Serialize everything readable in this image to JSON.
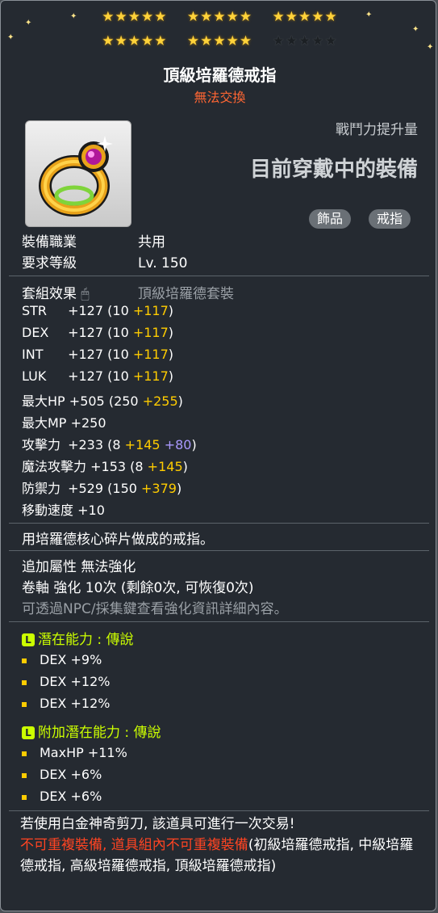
{
  "stars": {
    "row1": [
      "★★★★★",
      "★★★★★",
      "★★★★★"
    ],
    "row2_on": [
      "★★★★★",
      "★★★★★"
    ],
    "row2_off": "★★★★★"
  },
  "item": {
    "name": "頂級培羅德戒指",
    "trade_status": "無法交換",
    "combat_power_label": "戰鬥力提升量",
    "equipped_text": "目前穿戴中的裝備",
    "tags": [
      "飾品",
      "戒指"
    ]
  },
  "requirements": {
    "job_label": "裝備職業",
    "job_value": "共用",
    "level_label": "要求等級",
    "level_value": "Lv. 150"
  },
  "set": {
    "label": "套組效果",
    "value": "頂級培羅德套裝"
  },
  "stats": [
    {
      "name": "STR",
      "total": "+127",
      "base": "(10",
      "bonus": "+117",
      "bonus2": "",
      ")": ")"
    },
    {
      "name": "DEX",
      "total": "+127",
      "base": "(10",
      "bonus": "+117",
      "bonus2": "",
      ")": ")"
    },
    {
      "name": "INT",
      "total": "+127",
      "base": "(10",
      "bonus": "+117",
      "bonus2": "",
      ")": ")"
    },
    {
      "name": "LUK",
      "total": "+127",
      "base": "(10",
      "bonus": "+117",
      "bonus2": "",
      ")": ")"
    },
    {
      "name": "最大HP",
      "total": "+505",
      "base": "(250",
      "bonus": "+255",
      "bonus2": "",
      ")": ")"
    },
    {
      "name": "最大MP",
      "total": "+250",
      "base": "",
      "bonus": "",
      "bonus2": "",
      ")": ""
    },
    {
      "name": "攻擊力",
      "total": "+233",
      "base": "(8",
      "bonus": "+145",
      "bonus2": "+80",
      ")": ")"
    },
    {
      "name": "魔法攻擊力",
      "total": "+153",
      "base": "(8",
      "bonus": "+145",
      "bonus2": "",
      ")": ")"
    },
    {
      "name": "防禦力",
      "total": "+529",
      "base": "(150",
      "bonus": "+379",
      "bonus2": "",
      ")": ")"
    },
    {
      "name": "移動速度",
      "total": "+10",
      "base": "",
      "bonus": "",
      "bonus2": "",
      ")": ""
    }
  ],
  "description": "用培羅德核心碎片做成的戒指。",
  "extra": {
    "line1": "追加屬性 無法強化",
    "line2": "卷軸 強化 10次 (剩餘0次, 可恢復0次)",
    "line3": "可透過NPC/採集鍵查看強化資訊詳細內容。"
  },
  "potential": {
    "title": "潛在能力 : 傳說",
    "lines": [
      "DEX +9%",
      "DEX +12%",
      "DEX +12%"
    ]
  },
  "bonus_potential": {
    "title": "附加潛在能力 : 傳說",
    "lines": [
      "MaxHP +11%",
      "DEX +6%",
      "DEX +6%"
    ]
  },
  "trade_note": {
    "line1": "若使用白金神奇剪刀, 該道具可進行一次交易!",
    "warning": "不可重複裝備, 道具組內不可重複裝備",
    "rest": "(初級培羅德戒指, 中級培羅德戒指, 高級培羅德戒指, 頂級培羅德戒指)"
  },
  "colors": {
    "bonus": "#ffcc00",
    "scroll": "#aa99ff",
    "potential": "#ccff00",
    "warning": "#ff4422",
    "title_sub": "#ff6633"
  },
  "icon_name": "ring-icon"
}
